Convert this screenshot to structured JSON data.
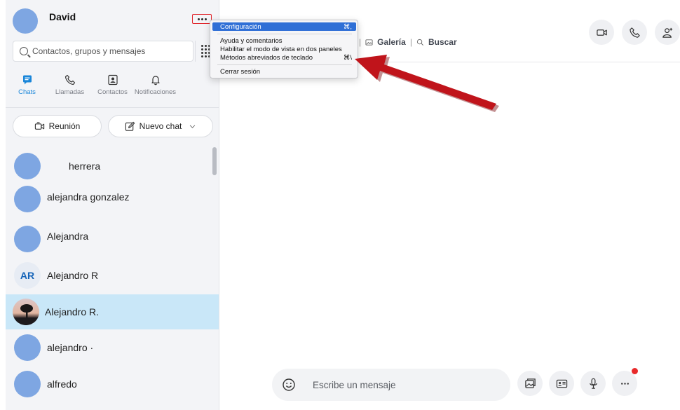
{
  "profile": {
    "name": "David"
  },
  "search": {
    "placeholder": "Contactos, grupos y mensajes"
  },
  "tabs": [
    {
      "label": "Chats",
      "icon": "chat-icon",
      "active": true
    },
    {
      "label": "Llamadas",
      "icon": "phone-icon"
    },
    {
      "label": "Contactos",
      "icon": "contacts-icon"
    },
    {
      "label": "Notificaciones",
      "icon": "bell-icon"
    }
  ],
  "actions": {
    "meeting": "Reunión",
    "new_chat": "Nuevo chat"
  },
  "chats": [
    {
      "name": "herrera",
      "avatar": "blank"
    },
    {
      "name": "alejandra gonzalez",
      "avatar": "blank"
    },
    {
      "name": "Alejandra",
      "avatar": "blank"
    },
    {
      "name": "Alejandro R",
      "avatar": "initials",
      "initials": "AR"
    },
    {
      "name": "Alejandro R.",
      "avatar": "photo",
      "selected": true
    },
    {
      "name": "alejandro ·",
      "avatar": "blank"
    },
    {
      "name": "alfredo",
      "avatar": "blank"
    }
  ],
  "conversation": {
    "gallery": "Galería",
    "search": "Buscar"
  },
  "menu": {
    "items": [
      {
        "label": "Configuración",
        "shortcut": "⌘,",
        "highlight": true
      },
      {
        "label": "Ayuda y comentarios",
        "shortcut": ""
      },
      {
        "label": "Habilitar el modo de vista en dos paneles",
        "shortcut": ""
      },
      {
        "label": "Métodos abreviados de teclado",
        "shortcut": "⌘\\"
      },
      {
        "label": "Cerrar sesión",
        "shortcut": ""
      }
    ]
  },
  "composer": {
    "placeholder": "Escribe un mensaje"
  },
  "colors": {
    "accent": "#1a86d9",
    "selected_row": "#c9e7f8",
    "avatar": "#7ea6e2",
    "arrow": "#c0141b",
    "menu_highlight": "#2f6fd6"
  }
}
